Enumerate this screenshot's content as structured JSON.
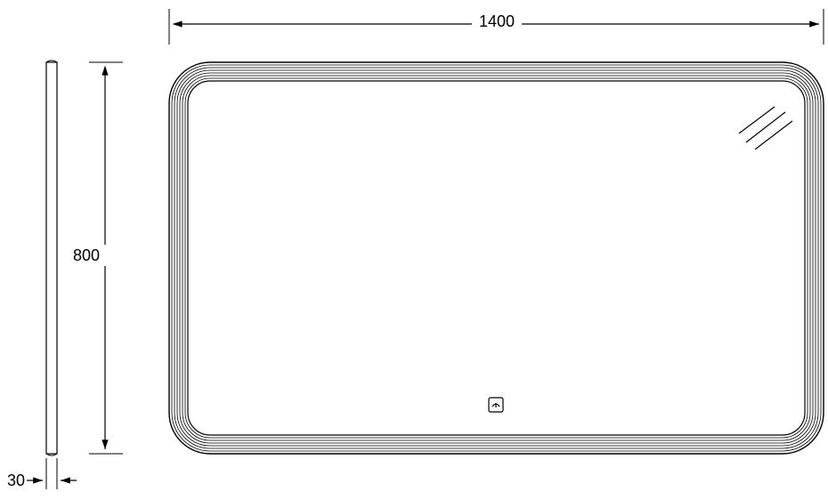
{
  "dimensions": {
    "width_mm": "1400",
    "height_mm": "800",
    "depth_mm": "30"
  },
  "object": {
    "name": "rounded-rectangular-mirror",
    "features": [
      "sensor-button",
      "reflection-mark"
    ]
  }
}
